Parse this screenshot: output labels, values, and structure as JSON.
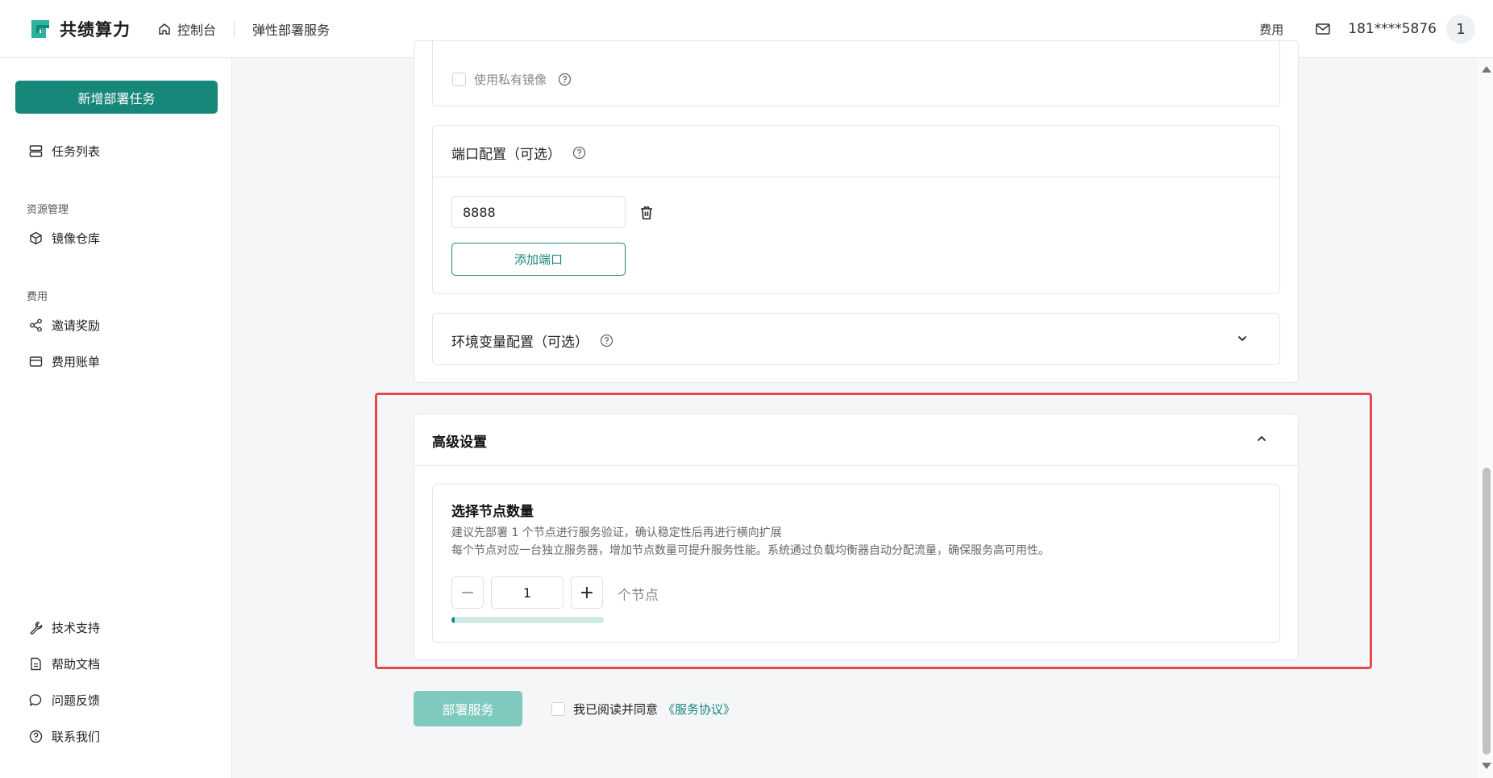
{
  "header": {
    "logo_text": "共绩算力",
    "nav_home": "控制台",
    "nav_current": "弹性部署服务",
    "fee": "费用",
    "phone": "181****5876",
    "avatar_text": "1"
  },
  "sidebar": {
    "new_task": "新增部署任务",
    "task_list": "任务列表",
    "group_resource": "资源管理",
    "image_repo": "镜像仓库",
    "group_fee": "费用",
    "invite": "邀请奖励",
    "bill": "费用账单",
    "support": "技术支持",
    "docs": "帮助文档",
    "feedback": "问题反馈",
    "contact": "联系我们"
  },
  "image_section": {
    "private_image_label": "使用私有镜像"
  },
  "port_section": {
    "title": "端口配置（可选）",
    "port_value": "8888",
    "add_port": "添加端口"
  },
  "env_section": {
    "title": "环境变量配置（可选）"
  },
  "advanced": {
    "title": "高级设置",
    "node_title": "选择节点数量",
    "desc_line1": "建议先部署 1 个节点进行服务验证，确认稳定性后再进行横向扩展",
    "desc_line2": "每个节点对应一台独立服务器，增加节点数量可提升服务性能。系统通过负载均衡器自动分配流量，确保服务高可用性。",
    "minus": "−",
    "plus": "+",
    "node_count": "1",
    "unit": "个节点",
    "progress_fraction": 0.02
  },
  "footer": {
    "deploy": "部署服务",
    "agree_text": "我已阅读并同意",
    "agreement_link": "《服务协议》"
  },
  "colors": {
    "accent": "#17877a",
    "highlight": "#e5484d"
  }
}
